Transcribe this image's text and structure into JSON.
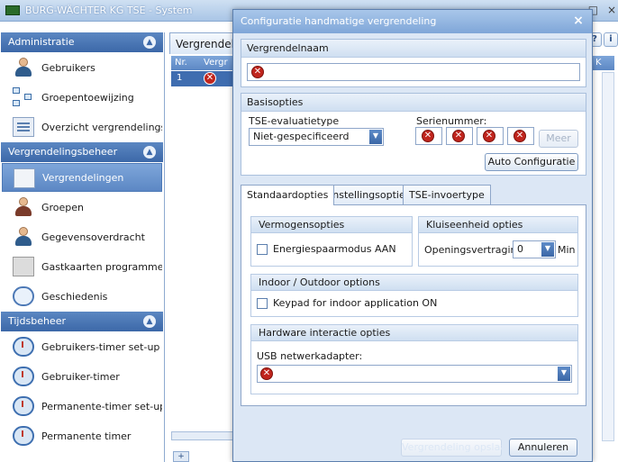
{
  "window": {
    "title": "BURG-WÄCHTER KG TSE - System",
    "buttons": [
      "—",
      "□",
      "×"
    ]
  },
  "sidebar": {
    "groups": [
      {
        "title": "Administratie",
        "items": [
          {
            "label": "Gebruikers",
            "icon": "users-icon"
          },
          {
            "label": "Groepentoewijzing",
            "icon": "group-assign-icon"
          },
          {
            "label": "Overzicht vergrendelingstoev",
            "icon": "overview-icon"
          }
        ]
      },
      {
        "title": "Vergrendelingsbeheer",
        "items": [
          {
            "label": "Vergrendelingen",
            "icon": "lock-icon",
            "selected": true
          },
          {
            "label": "Groepen",
            "icon": "groups-icon"
          },
          {
            "label": "Gegevensoverdracht",
            "icon": "data-transfer-icon"
          },
          {
            "label": "Gastkaarten programmeren",
            "icon": "guest-card-icon"
          },
          {
            "label": "Geschiedenis",
            "icon": "history-icon"
          }
        ]
      },
      {
        "title": "Tijdsbeheer",
        "items": [
          {
            "label": "Gebruikers-timer set-up",
            "icon": "timer-setup-icon"
          },
          {
            "label": "Gebruiker-timer",
            "icon": "user-timer-icon"
          },
          {
            "label": "Permanente-timer set-up",
            "icon": "permanent-timer-setup-icon"
          },
          {
            "label": "Permanente timer",
            "icon": "permanent-timer-icon"
          }
        ]
      }
    ]
  },
  "main": {
    "tab_label": "Vergrendeli",
    "grid": {
      "headers": [
        "Nr.",
        "Vergr"
      ],
      "row_nr": "1",
      "right_header": "K"
    },
    "help": "?",
    "extra": "i",
    "add": "+"
  },
  "dialog": {
    "title": "Configuratie handmatige vergrendeling",
    "close": "×",
    "name_section": {
      "title": "Vergrendelnaam",
      "value": ""
    },
    "basic": {
      "title": "Basisopties",
      "eval_label": "TSE-evaluatietype",
      "eval_value": "Niet-gespecificeerd",
      "serial_label": "Serienummer:",
      "serial_extra_button": "Meer",
      "auto_config": "Auto Configuratie"
    },
    "tabs": [
      "Standaardopties",
      "Instellingsopties",
      "TSE-invoertype"
    ],
    "active_tab": 0,
    "standard": {
      "power": {
        "title": "Vermogensopties",
        "checkbox": "Energiespaarmodus AAN",
        "checked": false
      },
      "safe": {
        "title": "Kluiseenheid opties",
        "delay_label": "Openingsvertraging",
        "delay_value": "0",
        "unit": "Min"
      },
      "indoor": {
        "title": "Indoor / Outdoor options",
        "checkbox": "Keypad for indoor application ON",
        "checked": false
      },
      "hardware": {
        "title": "Hardware interactie opties",
        "usb_label": "USB netwerkadapter:",
        "usb_value": ""
      }
    },
    "ok_button": "Vergrendeling opslaan",
    "cancel_button": "Annuleren"
  }
}
